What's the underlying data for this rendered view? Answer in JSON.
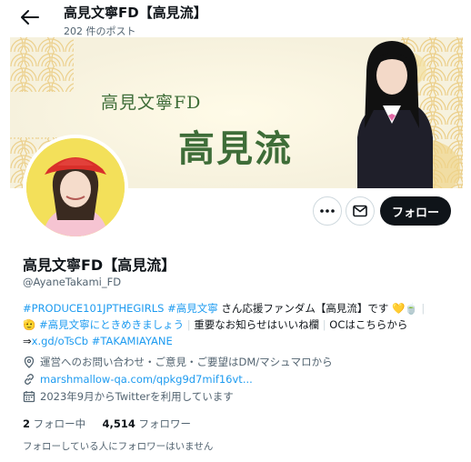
{
  "header": {
    "title": "高見文寧FD【高見流】",
    "post_count": "202 件のポスト",
    "back_icon": "arrow-left-icon"
  },
  "banner": {
    "small_text": "高見文寧FD",
    "big_text": "高見流",
    "colors": {
      "background": "#f6f1dd",
      "pattern": "#e9c879",
      "text": "#3e6d38"
    }
  },
  "actions": {
    "more_icon": "more-horizontal-icon",
    "message_icon": "envelope-icon",
    "follow_label": "フォロー"
  },
  "profile": {
    "name": "高見文寧FD【高見流】",
    "handle": "@AyaneTakami_FD",
    "bio": {
      "line1": {
        "tag1": "#PRODUCE101JPTHEGIRLS",
        "tag2": "#高見文寧",
        "text": " さん応援ファンダム【高見流】です",
        "emojis": "💛🍵"
      },
      "line2": {
        "emoji": "🫡",
        "tag": "#高見文寧にときめきましょう",
        "text1": "重要なお知らせはいいね欄",
        "text2": "OCはこちらから"
      },
      "line3": {
        "arrow": "⇒",
        "link": "x.gd/oTsCb",
        "tag": "#TAKAMIAYANE"
      }
    },
    "location": "運営へのお問い合わせ・ご意見・ご要望はDM/マシュマロから",
    "website": "marshmallow-qa.com/qpkg9d7mif16vt...",
    "joined": "2023年9月からTwitterを利用しています"
  },
  "stats": {
    "following_count": "2",
    "following_label": "フォロー中",
    "followers_count": "4,514",
    "followers_label": "フォロワー"
  },
  "followers_you_know": "フォローしている人にフォロワーはいません",
  "colors": {
    "accent": "#1d9bf0",
    "text_primary": "#0f1419",
    "text_secondary": "#536471"
  }
}
